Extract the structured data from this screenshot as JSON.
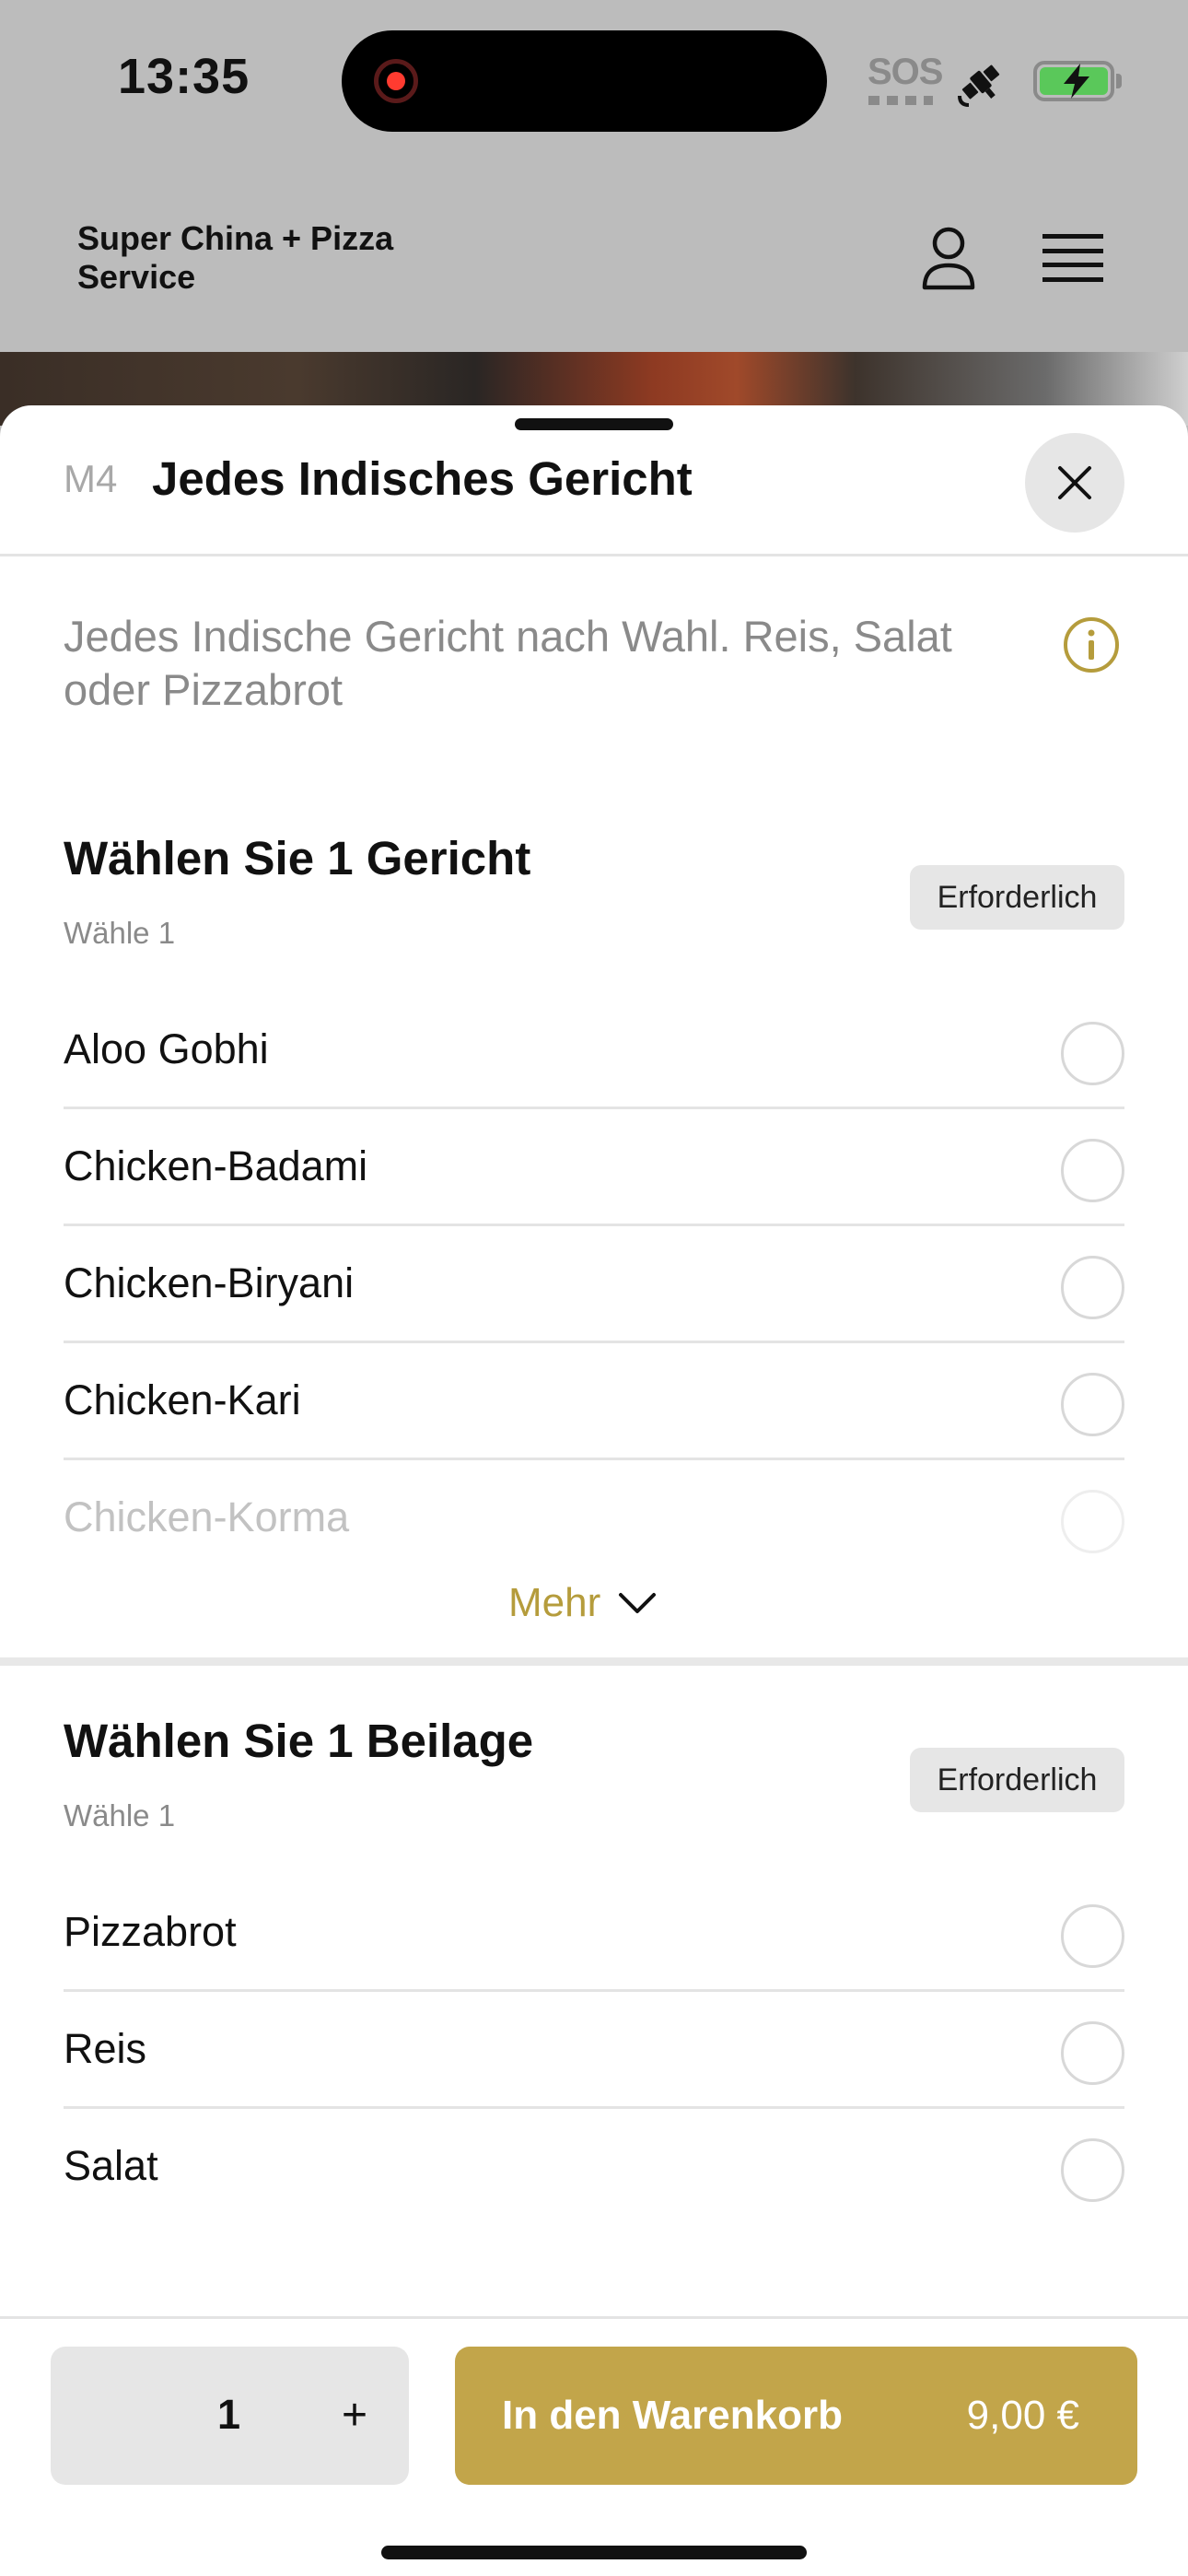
{
  "status_bar": {
    "time": "13:35",
    "sos_label": "SOS",
    "battery_color": "#5ac85a"
  },
  "header": {
    "brand_name": "Super China + Pizza\nService",
    "icons": [
      "profile-icon",
      "hamburger-menu-icon"
    ]
  },
  "sheet": {
    "item_code": "M4",
    "item_title": "Jedes Indisches Gericht",
    "description": "Jedes Indische Gericht nach Wahl. Reis, Salat oder Pizzabrot",
    "groups": [
      {
        "title": "Wählen Sie 1 Gericht",
        "subtitle": "Wähle 1",
        "badge": "Erforderlich",
        "options": [
          "Aloo Gobhi",
          "Chicken-Badami",
          "Chicken-Biryani",
          "Chicken-Kari",
          "Chicken-Korma"
        ],
        "more_label": "Mehr"
      },
      {
        "title": "Wählen Sie 1 Beilage",
        "subtitle": "Wähle 1",
        "badge": "Erforderlich",
        "options": [
          "Pizzabrot",
          "Reis",
          "Salat"
        ]
      }
    ]
  },
  "bottom_bar": {
    "quantity": "1",
    "plus_label": "+",
    "add_label": "In den Warenkorb",
    "price": "9,00 €"
  },
  "colors": {
    "accent": "#c2a54a",
    "accent_text": "#b59c3c",
    "header_bg": "#bcbcbc"
  }
}
